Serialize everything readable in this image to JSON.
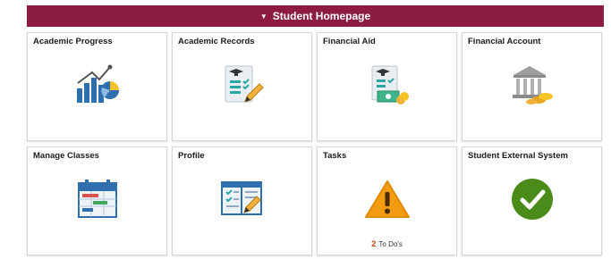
{
  "header": {
    "title": "Student Homepage",
    "caret": "▼"
  },
  "tiles": [
    {
      "title": "Academic Progress",
      "icon": "progress-chart-icon"
    },
    {
      "title": "Academic Records",
      "icon": "records-document-icon"
    },
    {
      "title": "Financial Aid",
      "icon": "financial-aid-document-icon"
    },
    {
      "title": "Financial Account",
      "icon": "bank-coins-icon"
    },
    {
      "title": "Manage Classes",
      "icon": "calendar-icon"
    },
    {
      "title": "Profile",
      "icon": "profile-form-icon"
    },
    {
      "title": "Tasks",
      "icon": "warning-icon",
      "badge": {
        "count": "2",
        "label": "To Do's"
      }
    },
    {
      "title": "Student External System",
      "icon": "checkmark-circle-icon"
    }
  ],
  "colors": {
    "header_bg": "#8c1d40",
    "accent_blue": "#2f6fae",
    "warning_orange": "#f39c12",
    "success_green": "#4b8b1a"
  }
}
